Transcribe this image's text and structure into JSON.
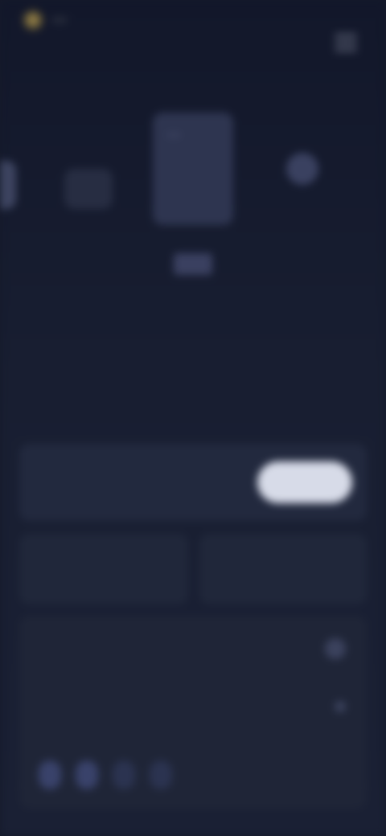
{
  "header": {
    "logo_text": "",
    "link": "",
    "menu_icon": "hamburger-icon"
  },
  "carousel": {
    "featured_title": ""
  },
  "hero": {
    "title": "",
    "subtitle": ""
  },
  "tabs": [
    {
      "label": ""
    },
    {
      "label": ""
    },
    {
      "label": ""
    }
  ],
  "connect": {
    "label": "",
    "button_label": ""
  },
  "info": {
    "left_label": "",
    "left_value": "",
    "right_label": "",
    "right_value": ""
  },
  "panel": {
    "from_label": "",
    "from_value": "",
    "to_label": "",
    "to_value": "",
    "chips": [
      "",
      "",
      "",
      ""
    ]
  }
}
